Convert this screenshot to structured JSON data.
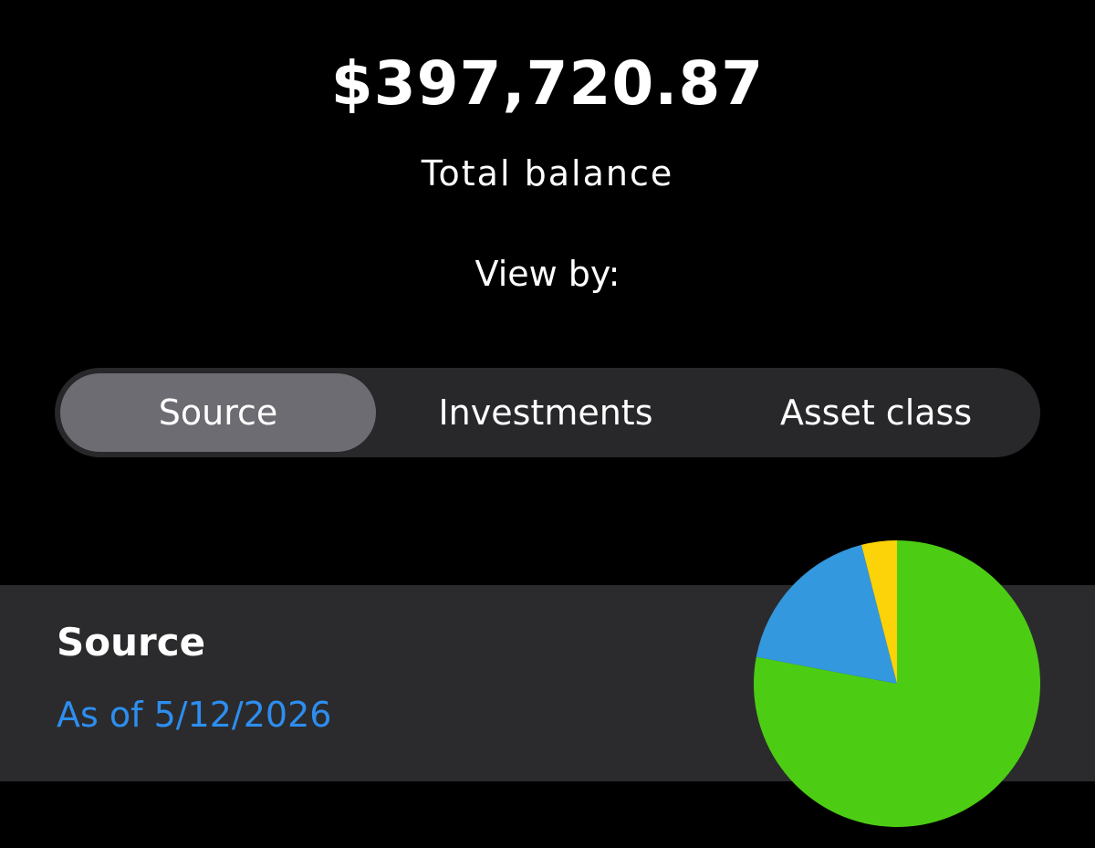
{
  "balance": {
    "amount": "$397,720.87",
    "label": "Total balance"
  },
  "view_by": {
    "label": "View by:",
    "tabs": [
      {
        "label": "Source",
        "active": true
      },
      {
        "label": "Investments",
        "active": false
      },
      {
        "label": "Asset class",
        "active": false
      }
    ]
  },
  "source_panel": {
    "title": "Source",
    "as_of": "As of 5/12/2026"
  },
  "colors": {
    "background": "#000000",
    "panel": "#2b2b2d",
    "segment_track": "#28282b",
    "segment_active": "#6c6c72",
    "link_blue": "#2d8ef0"
  },
  "chart_data": {
    "type": "pie",
    "slices": [
      {
        "value": 78,
        "color": "#4ccd14"
      },
      {
        "value": 18,
        "color": "#3398de"
      },
      {
        "value": 4,
        "color": "#fcd208"
      }
    ]
  }
}
